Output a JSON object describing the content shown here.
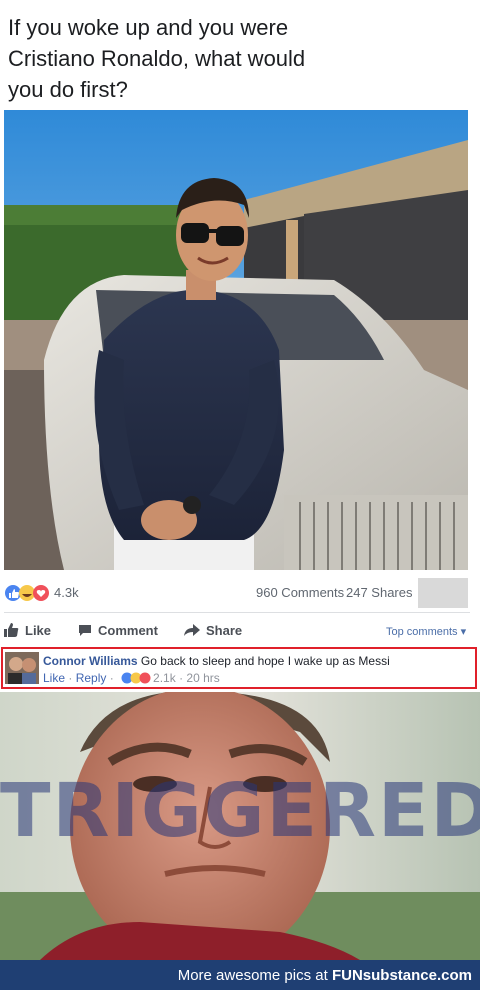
{
  "post": {
    "text": "If you woke up and you were\nCristiano Ronaldo, what would\nyou do first?"
  },
  "reactions": {
    "icons": [
      "like-icon",
      "haha-icon",
      "love-icon"
    ],
    "count": "4.3k",
    "comments": "960 Comments",
    "shares": "247 Shares"
  },
  "actions": {
    "like": "Like",
    "comment": "Comment",
    "share": "Share",
    "sort": "Top comments ▾"
  },
  "comment": {
    "author": "Connor Williams",
    "text": "Go back to sleep and hope I wake up as Messi",
    "like": "Like",
    "sep1": " · ",
    "reply": "Reply",
    "sep2": " · ",
    "reaction_count": "2.1k",
    "sep3": " · ",
    "time": "20 hrs"
  },
  "meme": {
    "caption": "TRIGGERED"
  },
  "footer": {
    "prefix": "More awesome pics at ",
    "brand": "FUNsubstance.com"
  },
  "colors": {
    "facebook_blue": "#4267b2",
    "highlight_red": "#e0202a",
    "footer_bg": "#1f3f73"
  }
}
